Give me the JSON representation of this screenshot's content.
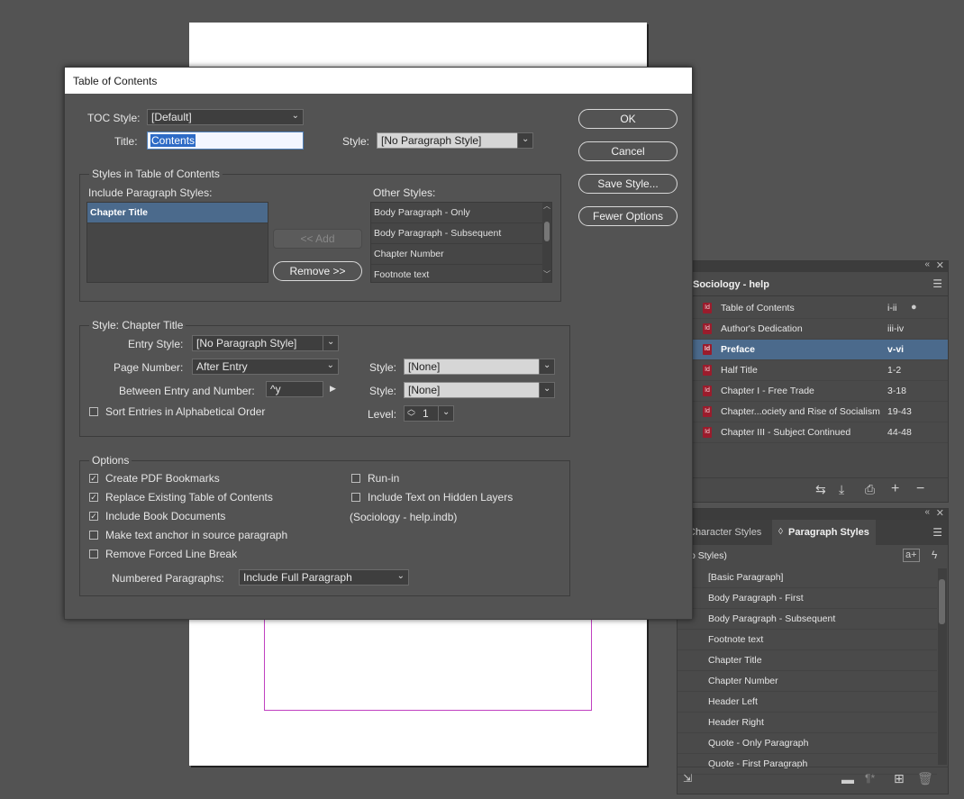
{
  "dialog": {
    "title": "Table of Contents",
    "toc_style_label": "TOC Style:",
    "toc_style_value": "[Default]",
    "title_label": "Title:",
    "title_value": "Contents",
    "style_label": "Style:",
    "title_style_value": "[No Paragraph Style]",
    "buttons": {
      "ok": "OK",
      "cancel": "Cancel",
      "save_style": "Save Style...",
      "fewer_options": "Fewer Options"
    },
    "styles_group": {
      "label": "Styles in Table of Contents",
      "include_label": "Include Paragraph Styles:",
      "include_items": [
        "Chapter Title"
      ],
      "add_button": "<< Add",
      "remove_button": "Remove >>",
      "other_label": "Other Styles:",
      "other_items": [
        "Body Paragraph - Only",
        "Body Paragraph - Subsequent",
        "Chapter Number",
        "Footnote text"
      ]
    },
    "style_group": {
      "label": "Style: Chapter Title",
      "entry_style_label": "Entry Style:",
      "entry_style_value": "[No Paragraph Style]",
      "page_number_label": "Page Number:",
      "page_number_value": "After Entry",
      "between_label": "Between Entry and Number:",
      "between_value": "^y",
      "style_label": "Style:",
      "page_number_style_value": "[None]",
      "between_style_value": "[None]",
      "sort_label": "Sort Entries in Alphabetical Order",
      "level_label": "Level:",
      "level_value": "1"
    },
    "options": {
      "label": "Options",
      "create_pdf": "Create PDF Bookmarks",
      "replace_existing": "Replace Existing Table of Contents",
      "include_book": "Include Book Documents",
      "make_anchor": "Make text anchor in source paragraph",
      "remove_break": "Remove Forced Line Break",
      "run_in": "Run-in",
      "include_hidden": "Include Text on Hidden Layers",
      "book_name": "(Sociology - help.indb)",
      "numbered_label": "Numbered Paragraphs:",
      "numbered_value": "Include Full Paragraph",
      "checked": {
        "create_pdf": true,
        "replace_existing": true,
        "include_book": true,
        "make_anchor": false,
        "remove_break": false,
        "run_in": false,
        "include_hidden": false,
        "sort": false
      }
    }
  },
  "book_panel": {
    "title": "Sociology - help",
    "icon_text": "Id",
    "items": [
      {
        "name": "Table of Contents",
        "pages": "i-ii",
        "selected": false,
        "open": true
      },
      {
        "name": "Author's Dedication",
        "pages": "iii-iv",
        "selected": false,
        "open": false
      },
      {
        "name": "Preface",
        "pages": "v-vi",
        "selected": true,
        "open": false
      },
      {
        "name": "Half Title",
        "pages": "1-2",
        "selected": false,
        "open": false
      },
      {
        "name": "Chapter I - Free Trade",
        "pages": "3-18",
        "selected": false,
        "open": false
      },
      {
        "name": "Chapter...ociety and Rise of Socialism",
        "pages": "19-43",
        "selected": false,
        "open": false
      },
      {
        "name": "Chapter III - Subject Continued",
        "pages": "44-48",
        "selected": false,
        "open": false
      }
    ]
  },
  "styles_panel": {
    "tab_character": "Character Styles",
    "tab_paragraph": "Paragraph Styles",
    "current": "o Styles)",
    "items": [
      "[Basic Paragraph]",
      "Body Paragraph - First",
      "Body Paragraph - Subsequent",
      "Footnote text",
      "Chapter Title",
      "Chapter Number",
      "Header Left",
      "Header Right",
      "Quote - Only Paragraph",
      "Quote - First Paragraph"
    ]
  }
}
